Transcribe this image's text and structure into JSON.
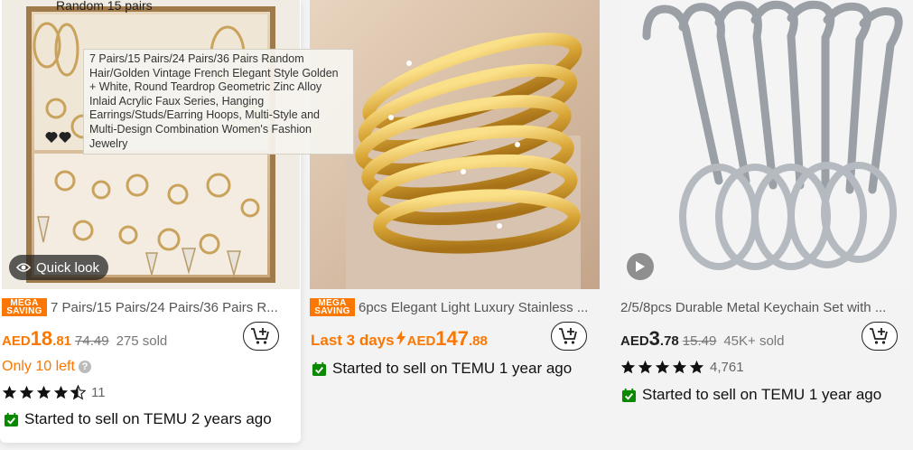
{
  "products": [
    {
      "image_label": "Random 15 pairs",
      "tooltip": "7 Pairs/15 Pairs/24 Pairs/36 Pairs Random Hair/Golden Vintage French Elegant Style Golden + White, Round Teardrop Geometric Zinc Alloy Inlaid Acrylic Faux Series, Hanging Earrings/Studs/Earring Hoops, Multi-Style and Multi-Design Combination Women's Fashion Jewelry",
      "quick_look": "Quick look",
      "badge_top": "MEGA",
      "badge_bottom": "SAVING",
      "title": "7 Pairs/15 Pairs/24 Pairs/36 Pairs R...",
      "currency": "AED",
      "price_main": "18",
      "price_dec": ".81",
      "old_price": "74.49",
      "sold": "275 sold",
      "stock_note": "Only 10 left",
      "help_icon": "question-icon",
      "rating_stars": 4.5,
      "reviews": "11",
      "started": "Started to sell on TEMU 2 years ago"
    },
    {
      "badge_top": "MEGA",
      "badge_bottom": "SAVING",
      "title": "6pcs Elegant Light Luxury Stainless ...",
      "promo": "Last 3 days",
      "currency": "AED",
      "price_main": "147",
      "price_dec": ".88",
      "started": "Started to sell on TEMU 1 year ago"
    },
    {
      "title": "2/5/8pcs Durable Metal Keychain Set with ...",
      "currency": "AED",
      "price_main": "3",
      "price_dec": ".78",
      "old_price": "15.49",
      "sold": "45K+ sold",
      "rating_stars": 5,
      "reviews": "4,761",
      "started": "Started to sell on TEMU 1 year ago"
    }
  ],
  "colors": {
    "accent": "#fb7701",
    "check": "#0a8800"
  }
}
